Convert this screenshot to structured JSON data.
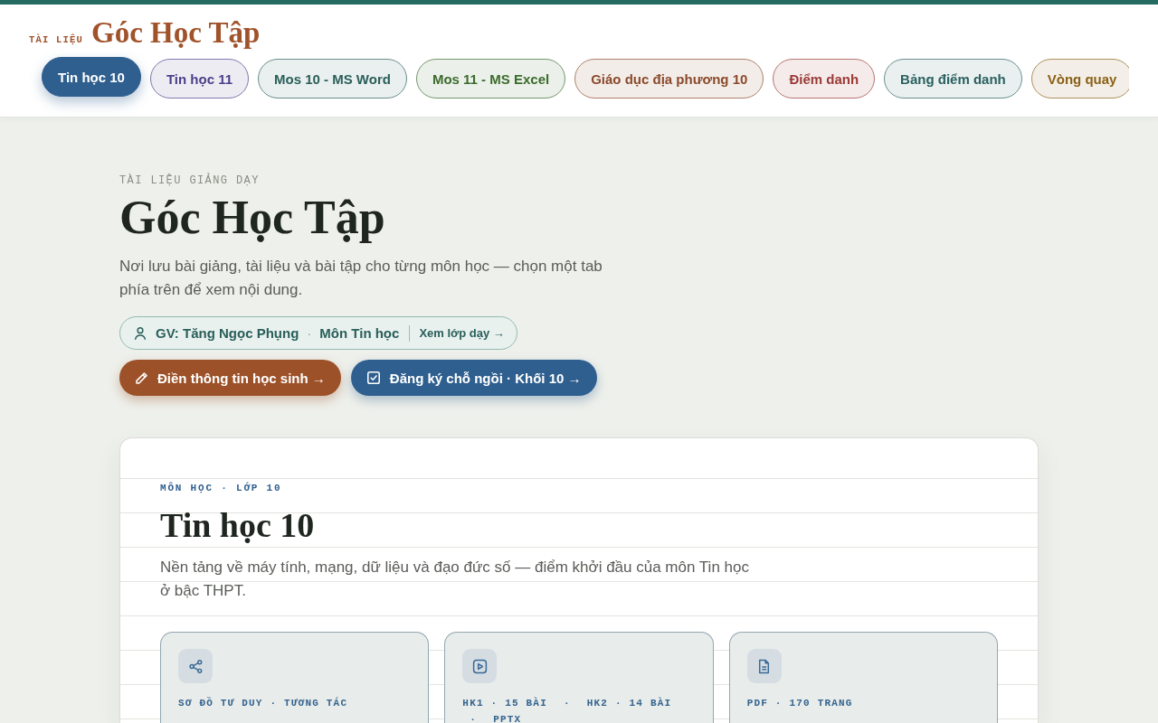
{
  "header": {
    "brand_tag": "TÀI LIỆU",
    "brand_title": "Góc Học Tập"
  },
  "tabs": [
    {
      "label": "Tin học 10",
      "selected": true,
      "color": "#2f5f8f"
    },
    {
      "label": "Tin học 11",
      "selected": false,
      "color": "#4b3f8a"
    },
    {
      "label": "Mos 10 - MS Word",
      "selected": false,
      "color": "#2a5f5a"
    },
    {
      "label": "Mos 11 - MS Excel",
      "selected": false,
      "color": "#3b6b2c"
    },
    {
      "label": "Giáo dục địa phương 10",
      "selected": false,
      "color": "#8a4a2a"
    },
    {
      "label": "Điểm danh",
      "selected": false,
      "color": "#9a3a35"
    },
    {
      "label": "Bảng điểm danh",
      "selected": false,
      "color": "#2a6060"
    },
    {
      "label": "Vòng quay",
      "selected": false,
      "color": "#8a6015"
    }
  ],
  "hero": {
    "eyebrow": "TÀI LIỆU GIẢNG DẠY",
    "title": "Góc Học Tập",
    "subtitle": "Nơi lưu bài giảng, tài liệu và bài tập cho từng môn học — chọn một tab phía trên để xem nội dung.",
    "teacher_info": {
      "teacher": "GV: Tăng Ngọc Phụng",
      "separator": "·",
      "subject": "Môn Tin học",
      "link": "Xem lớp dạy →"
    },
    "actions": [
      {
        "label": "Điền thông tin học sinh →",
        "kind": "edit",
        "color": "#9c5128"
      },
      {
        "label": "Đăng ký chỗ ngồi · Khối 10 →",
        "kind": "register",
        "color": "#2f5f8f"
      }
    ]
  },
  "subject_card": {
    "eyebrow": "MÔN HỌC · LỚP 10",
    "title": "Tin học 10",
    "description": "Nền tảng về máy tính, mạng, dữ liệu và đạo đức số — điểm khởi đầu của môn Tin học ở bậc THPT.",
    "resources": [
      {
        "kind": "mindmap",
        "meta": [
          "SƠ ĐỒ TƯ DUY · TƯƠNG TÁC"
        ]
      },
      {
        "kind": "slides",
        "meta": [
          "HK1 · 15 BÀI",
          "·",
          "HK2 · 14 BÀI",
          "·",
          "PPTX"
        ]
      },
      {
        "kind": "document",
        "meta": [
          "PDF · 170 TRANG"
        ]
      }
    ]
  }
}
